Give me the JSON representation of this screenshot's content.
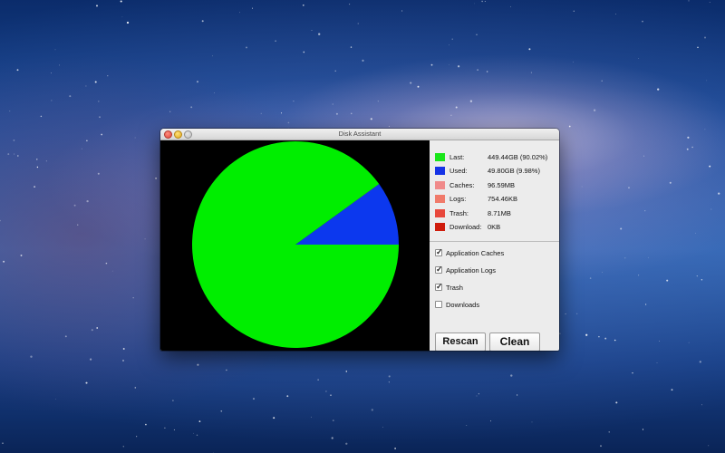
{
  "window": {
    "title": "Disk Assistant"
  },
  "legend": [
    {
      "label": "Last:",
      "value": "449.44GB (90.02%)",
      "color": "#19e619"
    },
    {
      "label": "Used:",
      "value": "49.80GB (9.98%)",
      "color": "#1533e6"
    },
    {
      "label": "Caches:",
      "value": "96.59MB",
      "color": "#f08a8a"
    },
    {
      "label": "Logs:",
      "value": "754.46KB",
      "color": "#f07a6a"
    },
    {
      "label": "Trash:",
      "value": "8.71MB",
      "color": "#e8483c"
    },
    {
      "label": "Download:",
      "value": "0KB",
      "color": "#cf1c0c"
    }
  ],
  "options": [
    {
      "label": "Application Caches",
      "checked": true
    },
    {
      "label": "Application Logs",
      "checked": true
    },
    {
      "label": "Trash",
      "checked": true
    },
    {
      "label": "Downloads",
      "checked": false
    }
  ],
  "buttons": {
    "rescan": "Rescan",
    "clean": "Clean"
  },
  "chart_data": {
    "type": "pie",
    "title": "",
    "slices": [
      {
        "label": "Last",
        "value": 90.02,
        "color": "#00ee00"
      },
      {
        "label": "Used",
        "value": 9.98,
        "color": "#0c38ee"
      },
      {
        "label": "Caches",
        "value": 0.02,
        "color": "#f08a8a"
      },
      {
        "label": "Logs",
        "value": 0.0,
        "color": "#f07a6a"
      },
      {
        "label": "Trash",
        "value": 0.0,
        "color": "#e8483c"
      },
      {
        "label": "Download",
        "value": 0.0,
        "color": "#cf1c0c"
      }
    ]
  }
}
